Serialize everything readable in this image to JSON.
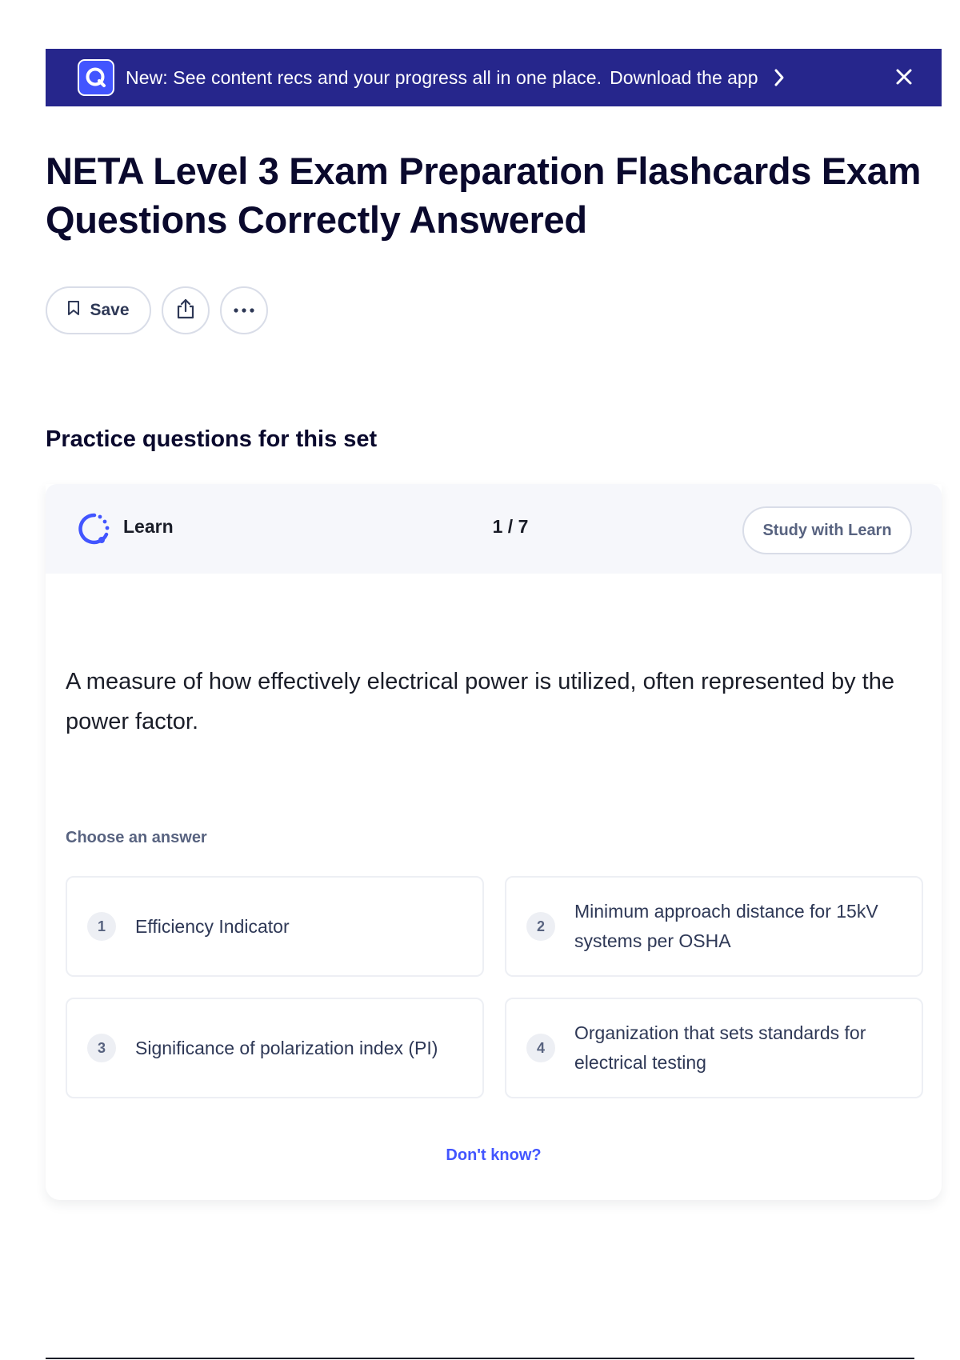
{
  "banner": {
    "text": "New: See content recs and your progress all in one place.",
    "link": "Download the app",
    "logo_icon": "quizlet-logo-icon",
    "chevron_icon": "chevron-right-icon",
    "close_icon": "close-icon",
    "background": "#26268c"
  },
  "title": "NETA Level 3 Exam Preparation Flashcards Exam Questions Correctly Answered",
  "actions": {
    "save_label": "Save",
    "save_icon": "bookmark-icon",
    "share_icon": "share-icon",
    "more_icon": "more-horizontal-icon"
  },
  "practice": {
    "heading": "Practice questions for this set",
    "mode_label": "Learn",
    "mode_icon": "learn-progress-icon",
    "counter": "1 / 7",
    "study_button": "Study with Learn",
    "question": "A measure of how effectively electrical power is utilized, often represented by the power factor.",
    "choose_label": "Choose an answer",
    "options": [
      {
        "num": "1",
        "text": "Efficiency Indicator"
      },
      {
        "num": "2",
        "text": "Minimum approach distance for 15kV systems per OSHA"
      },
      {
        "num": "3",
        "text": "Significance of polarization index (PI)"
      },
      {
        "num": "4",
        "text": "Organization that sets standards for electrical testing"
      }
    ],
    "dont_know": "Don't know?",
    "accent_color": "#4255ff"
  }
}
